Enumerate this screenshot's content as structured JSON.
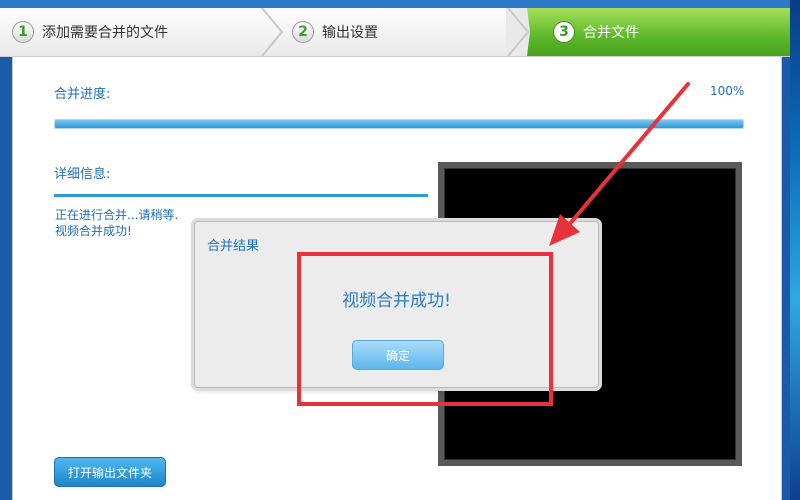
{
  "steps": [
    {
      "num": "1",
      "label": "添加需要合并的文件"
    },
    {
      "num": "2",
      "label": "输出设置"
    },
    {
      "num": "3",
      "label": "合并文件"
    }
  ],
  "progress": {
    "label": "合并进度:",
    "percent_text": "100%",
    "value": 1.0
  },
  "details": {
    "label": "详细信息:",
    "lines": [
      "正在进行合并...请稍等.",
      "视频合并成功!"
    ]
  },
  "open_folder_label": "打开输出文件夹",
  "dialog": {
    "title": "合并结果",
    "message": "视频合并成功!",
    "ok_label": "确定"
  },
  "colors": {
    "accent": "#2a9ad8",
    "active_step": "#5cb82a",
    "annotation": "#e8323a"
  },
  "icons": {
    "annotation_arrow": "arrow-icon"
  }
}
